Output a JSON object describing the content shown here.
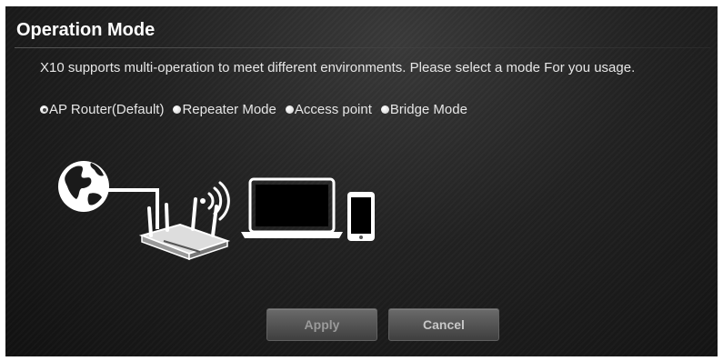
{
  "page": {
    "title": "Operation Mode",
    "description": "X10 supports multi-operation to meet different environments. Please select a mode For you usage."
  },
  "modes": [
    {
      "label": "AP Router(Default)",
      "selected": true
    },
    {
      "label": "Repeater Mode",
      "selected": false
    },
    {
      "label": "Access point",
      "selected": false
    },
    {
      "label": "Bridge Mode",
      "selected": false
    }
  ],
  "illustration": {
    "icons": [
      "globe-icon",
      "router-icon",
      "wifi-signal-icon",
      "laptop-icon",
      "smartphone-icon"
    ]
  },
  "buttons": {
    "apply_label": "Apply",
    "cancel_label": "Cancel"
  },
  "colors": {
    "panel_background": "#1c1c1c",
    "text": "#e6e6e6",
    "button_background": "#555555"
  }
}
